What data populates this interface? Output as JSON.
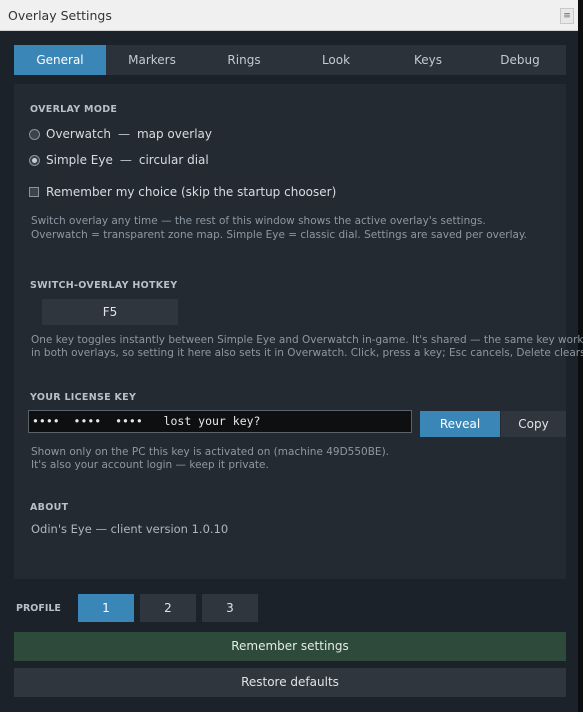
{
  "window": {
    "title": "Overlay Settings",
    "menu_glyph": "≡"
  },
  "tabs": [
    {
      "label": "General",
      "active": true
    },
    {
      "label": "Markers",
      "active": false
    },
    {
      "label": "Rings",
      "active": false
    },
    {
      "label": "Look",
      "active": false
    },
    {
      "label": "Keys",
      "active": false
    },
    {
      "label": "Debug",
      "active": false
    }
  ],
  "overlay_mode": {
    "label": "OVERLAY MODE",
    "separator": "—",
    "options": [
      {
        "name": "Overwatch",
        "desc": "map overlay",
        "selected": false
      },
      {
        "name": "Simple Eye",
        "desc": "circular dial",
        "selected": true
      }
    ],
    "remember_label": "Remember my choice (skip the startup chooser)",
    "remember_checked": false,
    "hint_line1": "Switch overlay any time — the rest of this window shows the active overlay's settings.",
    "hint_line2": "Overwatch = transparent zone map. Simple Eye = classic dial. Settings are saved per overlay."
  },
  "hotkey": {
    "label": "SWITCH-OVERLAY HOTKEY",
    "value": "F5",
    "hint_line1": "One key toggles instantly between Simple Eye and Overwatch in-game. It's shared — the same key works",
    "hint_line2": "in both overlays, so setting it here also sets it in Overwatch. Click, press a key; Esc cancels, Delete clears."
  },
  "license": {
    "label": "YOUR LICENSE KEY",
    "value": "••••  ••••  ••••   lost your key?",
    "reveal_label": "Reveal",
    "copy_label": "Copy",
    "hint_line1": "Shown only on the PC this key is activated on (machine 49D550BE).",
    "hint_line2": "It's also your account login — keep it private."
  },
  "about": {
    "label": "ABOUT",
    "text": "Odin's Eye — client version 1.0.10"
  },
  "profile": {
    "label": "PROFILE",
    "options": [
      "1",
      "2",
      "3"
    ],
    "active_index": 0
  },
  "actions": {
    "remember_label": "Remember settings",
    "restore_label": "Restore defaults"
  },
  "colors": {
    "accent": "#3a87b7",
    "background": "#1c2229",
    "panel": "#242a31",
    "remember_button": "#2d4a3b"
  }
}
